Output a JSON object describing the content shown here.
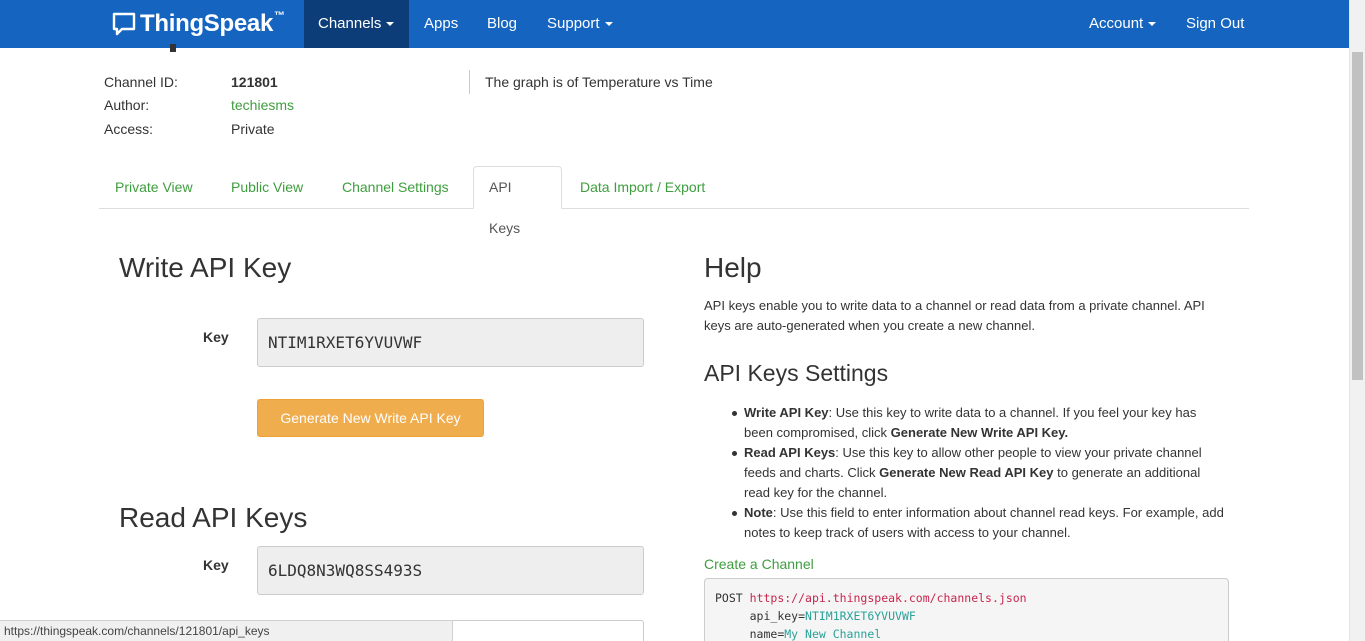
{
  "navbar": {
    "brand": "ThingSpeak",
    "brand_tm": "™",
    "items": [
      {
        "label": "Channels",
        "dropdown": true,
        "active": true
      },
      {
        "label": "Apps"
      },
      {
        "label": "Blog"
      },
      {
        "label": "Support",
        "dropdown": true
      }
    ],
    "right_items": [
      {
        "label": "Account",
        "dropdown": true
      },
      {
        "label": "Sign Out"
      }
    ],
    "color": "#1565c0"
  },
  "channel": {
    "id_label": "Channel ID:",
    "id_value": "121801",
    "author_label": "Author:",
    "author_value": "techiesms",
    "access_label": "Access:",
    "access_value": "Private",
    "description": "The graph is of Temperature vs Time"
  },
  "tabs": [
    {
      "label": "Private View"
    },
    {
      "label": "Public View"
    },
    {
      "label": "Channel Settings"
    },
    {
      "label": "API Keys",
      "active": true
    },
    {
      "label": "Data Import / Export"
    }
  ],
  "write_key": {
    "heading": "Write API Key",
    "key_label": "Key",
    "key_value": "NTIM1RXET6YVUVWF",
    "button_label": "Generate New Write API Key"
  },
  "read_keys": {
    "heading": "Read API Keys",
    "key_label": "Key",
    "key_value": "6LDQ8N3WQ8SS493S"
  },
  "help": {
    "heading": "Help",
    "intro": "API keys enable you to write data to a channel or read data from a private channel. API keys are auto-generated when you create a new channel.",
    "settings_heading": "API Keys Settings",
    "items": [
      {
        "term": "Write API Key",
        "text_before": ": Use this key to write data to a channel. If you feel your key has been compromised, click ",
        "bold": "Generate New Write API Key.",
        "text_after": ""
      },
      {
        "term": "Read API Keys",
        "text_before": ": Use this key to allow other people to view your private channel feeds and charts. Click ",
        "bold": "Generate New Read API Key",
        "text_after": " to generate an additional read key for the channel."
      },
      {
        "term": "Note",
        "text_before": ": Use this field to enter information about channel read keys. For example, add notes to keep track of users with access to your channel.",
        "bold": "",
        "text_after": ""
      }
    ],
    "create_link": "Create a Channel",
    "code": {
      "method": "POST",
      "url": "https://api.thingspeak.com/channels.json",
      "line2_key": "api_key=",
      "line2_val": "NTIM1RXET6YVUVWF",
      "line3_key": "name=",
      "line3_val": "My New Channel"
    }
  },
  "status_bar": "https://thingspeak.com/channels/121801/api_keys",
  "accent_colors": {
    "link": "#3e9e3e",
    "button": "#f0ad4e"
  }
}
